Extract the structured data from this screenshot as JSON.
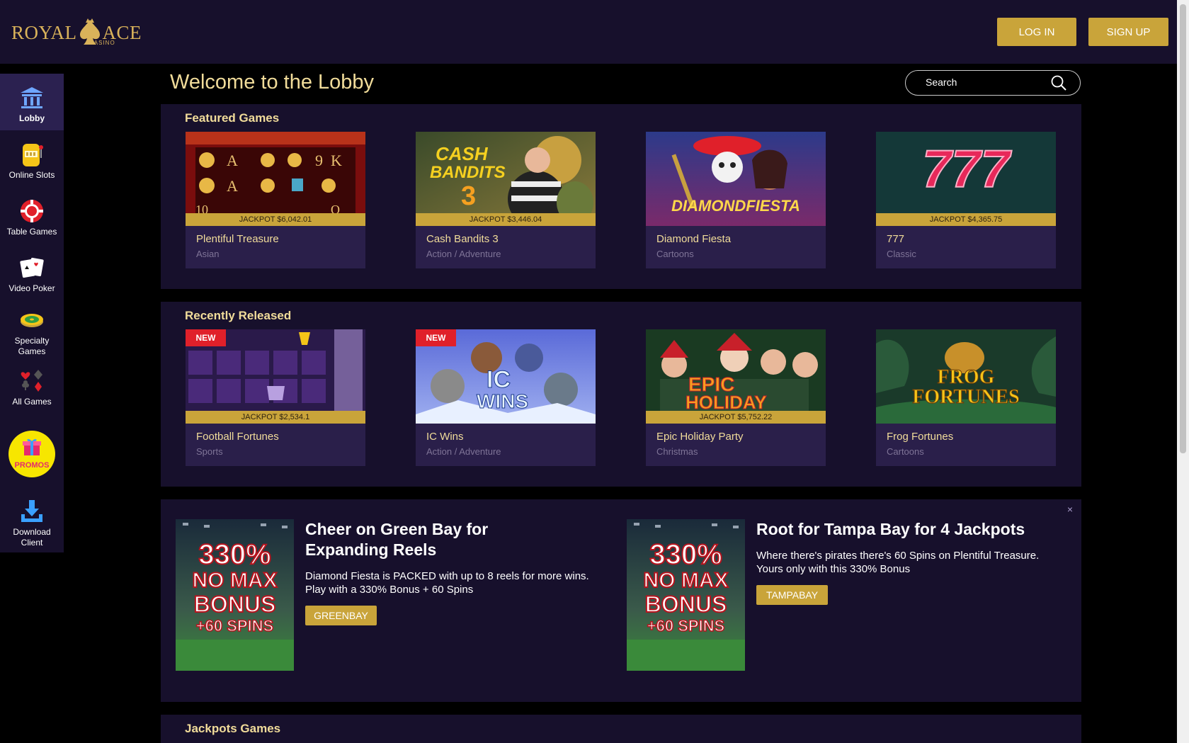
{
  "header": {
    "logo_left": "ROYAL",
    "logo_right": "ACE",
    "logo_sub": "CASINO",
    "login": "LOG IN",
    "signup": "SIGN UP"
  },
  "sidebar": {
    "items": [
      {
        "label": "Lobby",
        "icon": "bank-icon"
      },
      {
        "label": "Online Slots",
        "icon": "slot-machine-icon"
      },
      {
        "label": "Table Games",
        "icon": "poker-chip-icon"
      },
      {
        "label": "Video Poker",
        "icon": "playing-cards-icon"
      },
      {
        "label": "Specialty Games",
        "icon": "roulette-icon"
      },
      {
        "label": "All Games",
        "icon": "card-suits-icon"
      },
      {
        "label": "PROMOS",
        "icon": "gift-icon"
      },
      {
        "label": "Download Client",
        "icon": "download-icon"
      }
    ]
  },
  "lobby": {
    "title": "Welcome to the Lobby",
    "search_placeholder": "Search"
  },
  "featured": {
    "title": "Featured Games",
    "games": [
      {
        "name": "Plentiful Treasure",
        "category": "Asian",
        "jackpot": "JACKPOT $6,042.01"
      },
      {
        "name": "Cash Bandits 3",
        "category": "Action / Adventure",
        "jackpot": "JACKPOT $3,446.04"
      },
      {
        "name": "Diamond Fiesta",
        "category": "Cartoons",
        "jackpot": ""
      },
      {
        "name": "777",
        "category": "Classic",
        "jackpot": "JACKPOT $4,365.75"
      }
    ]
  },
  "recent": {
    "title": "Recently Released",
    "games": [
      {
        "name": "Football Fortunes",
        "category": "Sports",
        "jackpot": "JACKPOT $2,534.1",
        "badge": "NEW"
      },
      {
        "name": "IC Wins",
        "category": "Action / Adventure",
        "jackpot": "",
        "badge": "NEW"
      },
      {
        "name": "Epic Holiday Party",
        "category": "Christmas",
        "jackpot": "JACKPOT $5,752.22",
        "badge": ""
      },
      {
        "name": "Frog Fortunes",
        "category": "Cartoons",
        "jackpot": "",
        "badge": ""
      }
    ]
  },
  "thumb_text": {
    "cash_bandits_1": "CASH",
    "cash_bandits_2": "BANDITS",
    "cash_bandits_3": "3",
    "diamond_fiesta": "DIAMONDFIESTA",
    "sevens": "777",
    "ic_wins_1": "IC",
    "ic_wins_2": "WINS",
    "epic_holiday_1": "EPIC",
    "epic_holiday_2": "HOLIDAY",
    "frog_fortunes_1": "FROG",
    "frog_fortunes_2": "FORTUNES",
    "slot_symbols": [
      "A",
      "9",
      "K",
      "A",
      "10",
      "Q"
    ]
  },
  "promos": [
    {
      "title": "Cheer on Green Bay for Expanding Reels",
      "text": "Diamond Fiesta is PACKED with up to 8 reels for more wins. Play with a 330% Bonus + 60 Spins",
      "button": "GREENBAY",
      "image_lines": [
        "330%",
        "NO MAX",
        "BONUS",
        "+60 SPINS"
      ]
    },
    {
      "title": "Root for Tampa Bay for 4 Jackpots",
      "text": "Where there's pirates there's 60 Spins on Plentiful Treasure. Yours only with this 330% Bonus",
      "button": "TAMPABAY",
      "image_lines": [
        "330%",
        "NO MAX",
        "BONUS",
        "+60 SPINS"
      ]
    }
  ],
  "close_symbol": "×",
  "jackpots": {
    "title": "Jackpots Games"
  },
  "colors": {
    "bg": "#000000",
    "panel": "#17102c",
    "card": "#2a1f4a",
    "gold": "#c9a43a",
    "title_gold": "#f1dc9a",
    "muted": "#7f7497",
    "new_red": "#e0202a"
  }
}
